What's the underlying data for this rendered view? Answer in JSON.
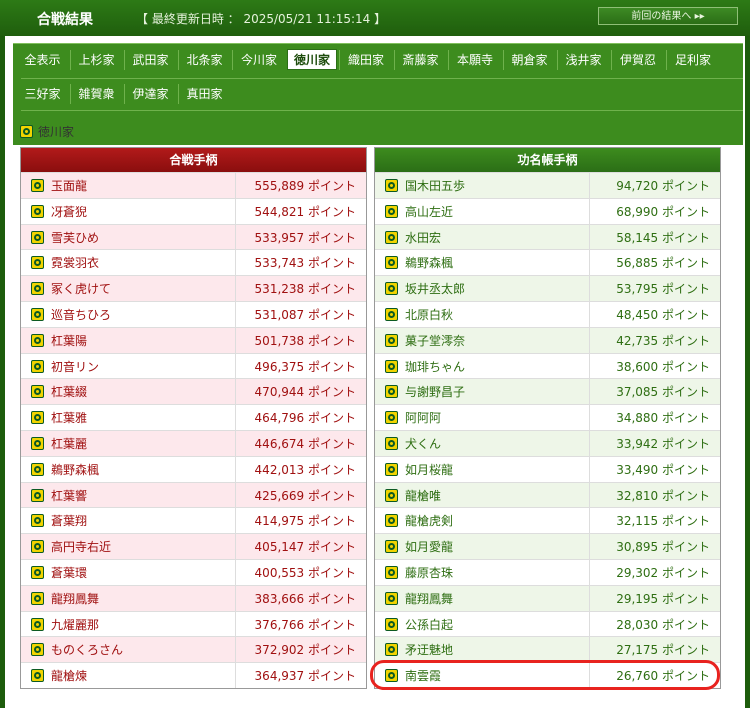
{
  "header": {
    "title": "合戦結果",
    "updated": "【 最終更新日時 ： 2025/05/21 11:15:14 】",
    "prev_button": "前回の結果へ ▸▸"
  },
  "tabs_row1": [
    "全表示",
    "上杉家",
    "武田家",
    "北条家",
    "今川家",
    "徳川家",
    "織田家",
    "斎藤家",
    "本願寺",
    "朝倉家",
    "浅井家",
    "伊賀忍",
    "足利家"
  ],
  "tabs_row2": [
    "三好家",
    "雑賀衆",
    "伊達家",
    "真田家"
  ],
  "active_tab": "徳川家",
  "section": {
    "label": "徳川家"
  },
  "left_table": {
    "header": "合戦手柄",
    "rows": [
      {
        "name": "玉面龍",
        "points": "555,889 ポイント"
      },
      {
        "name": "冴蒼猊",
        "points": "544,821 ポイント"
      },
      {
        "name": "雪芙ひめ",
        "points": "533,957 ポイント"
      },
      {
        "name": "霓裳羽衣",
        "points": "533,743 ポイント"
      },
      {
        "name": "冢く虎けて",
        "points": "531,238 ポイント"
      },
      {
        "name": "巡音ちひろ",
        "points": "531,087 ポイント"
      },
      {
        "name": "杠葉陽",
        "points": "501,738 ポイント"
      },
      {
        "name": "初音リン",
        "points": "496,375 ポイント"
      },
      {
        "name": "杠葉綴",
        "points": "470,944 ポイント"
      },
      {
        "name": "杠葉雅",
        "points": "464,796 ポイント"
      },
      {
        "name": "杠葉麗",
        "points": "446,674 ポイント"
      },
      {
        "name": "鵜野森楓",
        "points": "442,013 ポイント"
      },
      {
        "name": "杠葉響",
        "points": "425,669 ポイント"
      },
      {
        "name": "蒼葉翔",
        "points": "414,975 ポイント"
      },
      {
        "name": "高円寺右近",
        "points": "405,147 ポイント"
      },
      {
        "name": "蒼葉環",
        "points": "400,553 ポイント"
      },
      {
        "name": "龍翔鳳舞",
        "points": "383,666 ポイント"
      },
      {
        "name": "九燿麗那",
        "points": "376,766 ポイント"
      },
      {
        "name": "ものくろさん",
        "points": "372,902 ポイント"
      },
      {
        "name": "龍槍煉",
        "points": "364,937 ポイント"
      }
    ]
  },
  "right_table": {
    "header": "功名帳手柄",
    "rows": [
      {
        "name": "国木田五歩",
        "points": "94,720 ポイント"
      },
      {
        "name": "高山左近",
        "points": "68,990 ポイント"
      },
      {
        "name": "水田宏",
        "points": "58,145 ポイント"
      },
      {
        "name": "鵜野森楓",
        "points": "56,885 ポイント"
      },
      {
        "name": "坂井丞太郎",
        "points": "53,795 ポイント"
      },
      {
        "name": "北原白秋",
        "points": "48,450 ポイント"
      },
      {
        "name": "菓子堂澪奈",
        "points": "42,735 ポイント"
      },
      {
        "name": "珈琲ちゃん",
        "points": "38,600 ポイント"
      },
      {
        "name": "与謝野昌子",
        "points": "37,085 ポイント"
      },
      {
        "name": "阿阿阿",
        "points": "34,880 ポイント"
      },
      {
        "name": "犬くん",
        "points": "33,942 ポイント"
      },
      {
        "name": "如月桜龍",
        "points": "33,490 ポイント"
      },
      {
        "name": "龍槍唯",
        "points": "32,810 ポイント"
      },
      {
        "name": "龍槍虎剣",
        "points": "32,115 ポイント"
      },
      {
        "name": "如月愛龍",
        "points": "30,895 ポイント"
      },
      {
        "name": "藤原杏珠",
        "points": "29,302 ポイント"
      },
      {
        "name": "龍翔鳳舞",
        "points": "29,195 ポイント"
      },
      {
        "name": "公孫白起",
        "points": "28,030 ポイント"
      },
      {
        "name": "矛迂魅地",
        "points": "27,175 ポイント"
      },
      {
        "name": "南雲霞",
        "points": "26,760 ポイント"
      }
    ]
  },
  "icons": {
    "family_crest": "crest-icon"
  },
  "colors": {
    "header_green": "#1f5e0d",
    "tab_green": "#3d8c1e",
    "left_header_red": "#8a0e0e",
    "left_text_red": "#a01010",
    "right_text_green": "#2e6e12",
    "highlight_red": "#e8231f"
  }
}
